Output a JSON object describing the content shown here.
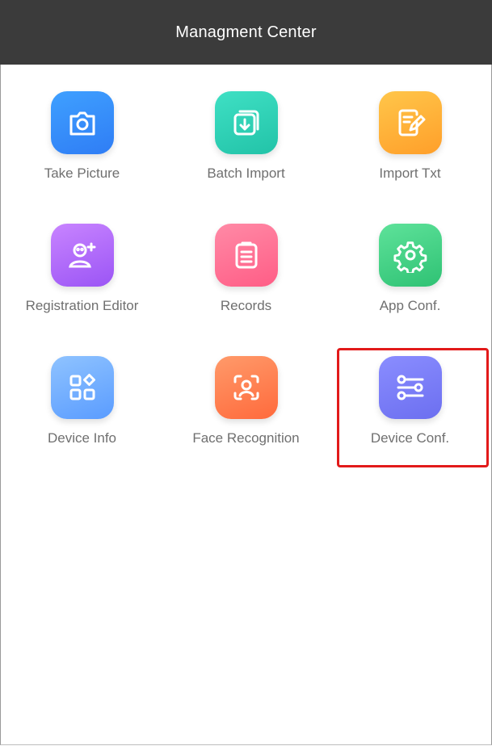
{
  "header": {
    "title": "Managment Center"
  },
  "tiles": [
    {
      "label": "Take Picture",
      "icon": "camera-icon",
      "color_from": "#3fa0ff",
      "color_to": "#2f7df5"
    },
    {
      "label": "Batch Import",
      "icon": "batch-import-icon",
      "color_from": "#3fe0c4",
      "color_to": "#22c3a8"
    },
    {
      "label": "Import Txt",
      "icon": "document-edit-icon",
      "color_from": "#ffc64a",
      "color_to": "#ff9f2a"
    },
    {
      "label": "Registration Editor",
      "icon": "add-person-icon",
      "color_from": "#c884ff",
      "color_to": "#9b55f5"
    },
    {
      "label": "Records",
      "icon": "clipboard-list-icon",
      "color_from": "#ff8aa6",
      "color_to": "#ff5d86"
    },
    {
      "label": "App Conf.",
      "icon": "gear-icon",
      "color_from": "#5ee29a",
      "color_to": "#2fc274"
    },
    {
      "label": "Device Info",
      "icon": "grid-apps-icon",
      "color_from": "#8fc3ff",
      "color_to": "#5a9cff"
    },
    {
      "label": "Face Recognition",
      "icon": "face-scan-icon",
      "color_from": "#ff9a6a",
      "color_to": "#ff6a3c"
    },
    {
      "label": "Device Conf.",
      "icon": "sliders-icon",
      "color_from": "#8a8dff",
      "color_to": "#6c6ff0"
    }
  ],
  "highlight": {
    "target": "Device Conf.",
    "color": "#e21a1a"
  }
}
